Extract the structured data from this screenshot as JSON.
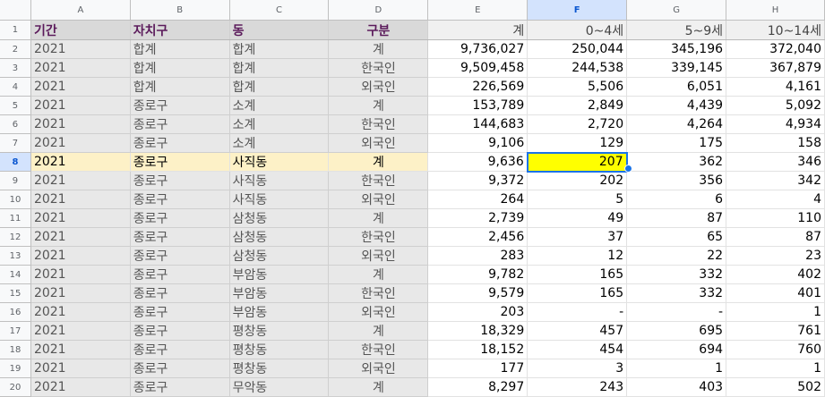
{
  "columns": [
    "A",
    "B",
    "C",
    "D",
    "E",
    "F",
    "G",
    "H"
  ],
  "selected_column": "F",
  "selected_row": 8,
  "header": [
    "기간",
    "자치구",
    "동",
    "구분",
    "계",
    "0~4세",
    "5~9세",
    "10~14세"
  ],
  "rows": [
    [
      "2021",
      "합계",
      "합계",
      "계",
      "9,736,027",
      "250,044",
      "345,196",
      "372,040"
    ],
    [
      "2021",
      "합계",
      "합계",
      "한국인",
      "9,509,458",
      "244,538",
      "339,145",
      "367,879"
    ],
    [
      "2021",
      "합계",
      "합계",
      "외국인",
      "226,569",
      "5,506",
      "6,051",
      "4,161"
    ],
    [
      "2021",
      "종로구",
      "소계",
      "계",
      "153,789",
      "2,849",
      "4,439",
      "5,092"
    ],
    [
      "2021",
      "종로구",
      "소계",
      "한국인",
      "144,683",
      "2,720",
      "4,264",
      "4,934"
    ],
    [
      "2021",
      "종로구",
      "소계",
      "외국인",
      "9,106",
      "129",
      "175",
      "158"
    ],
    [
      "2021",
      "종로구",
      "사직동",
      "계",
      "9,636",
      "207",
      "362",
      "346"
    ],
    [
      "2021",
      "종로구",
      "사직동",
      "한국인",
      "9,372",
      "202",
      "356",
      "342"
    ],
    [
      "2021",
      "종로구",
      "사직동",
      "외국인",
      "264",
      "5",
      "6",
      "4"
    ],
    [
      "2021",
      "종로구",
      "삼청동",
      "계",
      "2,739",
      "49",
      "87",
      "110"
    ],
    [
      "2021",
      "종로구",
      "삼청동",
      "한국인",
      "2,456",
      "37",
      "65",
      "87"
    ],
    [
      "2021",
      "종로구",
      "삼청동",
      "외국인",
      "283",
      "12",
      "22",
      "23"
    ],
    [
      "2021",
      "종로구",
      "부암동",
      "계",
      "9,782",
      "165",
      "332",
      "402"
    ],
    [
      "2021",
      "종로구",
      "부암동",
      "한국인",
      "9,579",
      "165",
      "332",
      "401"
    ],
    [
      "2021",
      "종로구",
      "부암동",
      "외국인",
      "203",
      "-",
      "-",
      "1"
    ],
    [
      "2021",
      "종로구",
      "평창동",
      "계",
      "18,329",
      "457",
      "695",
      "761"
    ],
    [
      "2021",
      "종로구",
      "평창동",
      "한국인",
      "18,152",
      "454",
      "694",
      "760"
    ],
    [
      "2021",
      "종로구",
      "평창동",
      "외국인",
      "177",
      "3",
      "1",
      "1"
    ],
    [
      "2021",
      "종로구",
      "무악동",
      "계",
      "8,297",
      "243",
      "403",
      "502"
    ]
  ],
  "colors": {
    "header_text": "#5b1a5b",
    "selected_header": "#d3e3fd",
    "active_cell_fill": "#ffff00",
    "selection_border": "#1a73e8",
    "row_highlight": "#fdf1c7"
  }
}
